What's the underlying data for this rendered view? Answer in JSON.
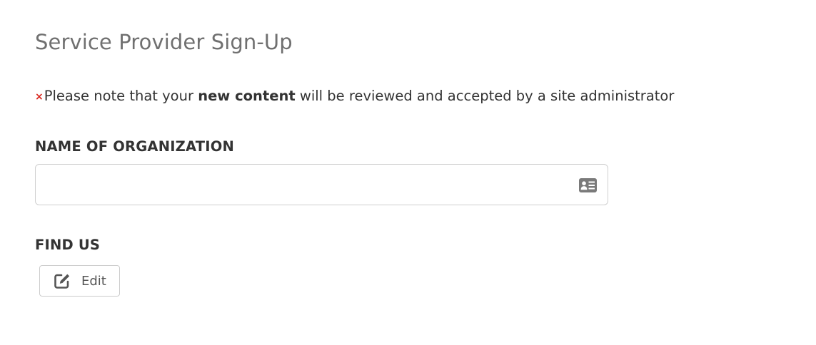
{
  "page": {
    "title": "Service Provider Sign-Up"
  },
  "notice": {
    "required_mark": "×",
    "text_before": "Please note that your ",
    "text_bold": "new content",
    "text_after": " will be reviewed and accepted by a site administrator"
  },
  "form": {
    "organization": {
      "label": "NAME OF ORGANIZATION",
      "value": "",
      "placeholder": "",
      "icon": "id-card-icon"
    },
    "find_us": {
      "label": "FIND US",
      "edit_button_label": "Edit",
      "edit_icon": "edit-icon"
    }
  },
  "colors": {
    "title": "#707070",
    "text": "#333333",
    "required_mark": "#d9241c",
    "border": "#cfcfcf",
    "icon": "#7a7a7a"
  }
}
